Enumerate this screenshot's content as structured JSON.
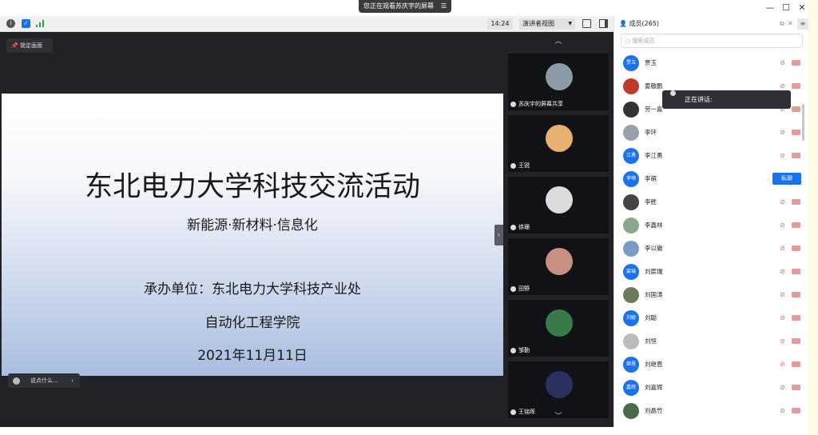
{
  "titlebar": {
    "watch_notice": "您正在观看苏庆宇的屏幕",
    "min": "—",
    "max": "☐",
    "close": "✕"
  },
  "toolbar": {
    "time": "14:24",
    "view_mode": "演讲者视图"
  },
  "stage": {
    "lock_label": "锁定画面",
    "chat_placeholder": "说点什么..."
  },
  "slide": {
    "title": "东北电力大学科技交流活动",
    "subtitle": "新能源·新材料·信息化",
    "organizer": "承办单位：东北电力大学科技产业处",
    "college": "自动化工程学院",
    "date": "2021年11月11日"
  },
  "thumbs": [
    {
      "name": "苏庆宇的屏幕共享",
      "color": "#8a9aa8"
    },
    {
      "name": "王锐",
      "color": "#e8b070"
    },
    {
      "name": "徐珊",
      "color": "#dcdcdc"
    },
    {
      "name": "田野",
      "color": "#c89080"
    },
    {
      "name": "邹勤",
      "color": "#3a7a4a"
    },
    {
      "name": "王铭晖",
      "color": "#2a3060"
    }
  ],
  "panel": {
    "title": "成员(265)",
    "search_placeholder": "搜索成员",
    "private_chat": "私聊",
    "speaking": "正在讲话:"
  },
  "members": [
    {
      "name": "贾玉",
      "avatar": "贾玉",
      "color": "#1a73e8"
    },
    {
      "name": "姜敬鹏",
      "avatar": "",
      "color": "#c0392b"
    },
    {
      "name": "劳一嘉",
      "avatar": "",
      "color": "#333333"
    },
    {
      "name": "李环",
      "avatar": "",
      "color": "#9aa0aa"
    },
    {
      "name": "李江勇",
      "avatar": "江勇",
      "color": "#1a73e8"
    },
    {
      "name": "李萌",
      "avatar": "李萌",
      "color": "#1a73e8"
    },
    {
      "name": "李胜",
      "avatar": "",
      "color": "#444444"
    },
    {
      "name": "李鑫林",
      "avatar": "",
      "color": "#8aa890"
    },
    {
      "name": "李以徽",
      "avatar": "",
      "color": "#7a9ac8"
    },
    {
      "name": "刘宸瑞",
      "avatar": "宸瑞",
      "color": "#1a73e8"
    },
    {
      "name": "刘国涛",
      "avatar": "",
      "color": "#6a7a5a"
    },
    {
      "name": "刘聪",
      "avatar": "刘聪",
      "color": "#1a73e8"
    },
    {
      "name": "刘恒",
      "avatar": "",
      "color": "#bbbbbb"
    },
    {
      "name": "刘继恩",
      "avatar": "继恩",
      "color": "#1a73e8"
    },
    {
      "name": "刘嘉辉",
      "avatar": "嘉辉",
      "color": "#1a73e8"
    },
    {
      "name": "刘晶竹",
      "avatar": "",
      "color": "#4a6a4a"
    }
  ]
}
